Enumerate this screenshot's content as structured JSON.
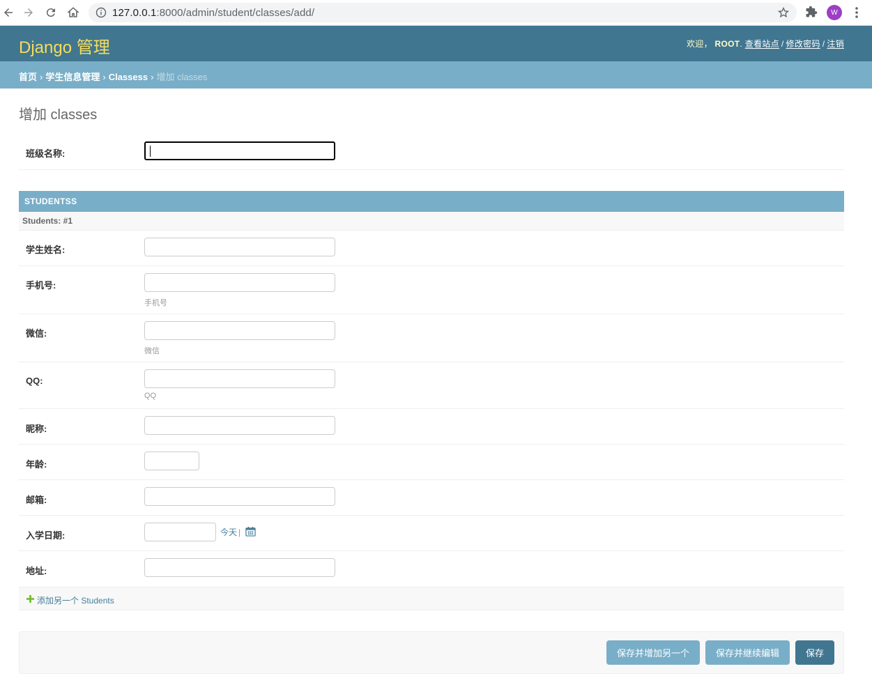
{
  "browser": {
    "url_host": "127.0.0.1",
    "url_rest": ":8000/admin/student/classes/add/",
    "avatar_letter": "W"
  },
  "header": {
    "brand": "Django 管理",
    "welcome": "欢迎，",
    "username": "ROOT",
    "view_site": "查看站点",
    "change_password": "修改密码",
    "logout": "注销"
  },
  "breadcrumbs": {
    "home": "首页",
    "app": "学生信息管理",
    "model": "Classess",
    "current": "增加 classes"
  },
  "page": {
    "title": "增加 classes",
    "class_name_label": "班级名称:"
  },
  "inline": {
    "heading": "STUDENTSS",
    "subheading": "Students: #1",
    "fields": {
      "name": "学生姓名:",
      "phone": "手机号:",
      "phone_help": "手机号",
      "wechat": "微信:",
      "wechat_help": "微信",
      "qq": "QQ:",
      "qq_help": "QQ",
      "nickname": "昵称:",
      "age": "年龄:",
      "email": "邮箱:",
      "enroll_date": "入学日期:",
      "address": "地址:"
    },
    "today_label": "今天",
    "today_sep": "|",
    "add_another": "添加另一个 Students"
  },
  "submit": {
    "save_add_another": "保存并增加另一个",
    "save_continue": "保存并继续编辑",
    "save": "保存"
  },
  "colors": {
    "header_bg": "#417690",
    "breadcrumb_bg": "#79aec8",
    "brand_yellow": "#f5dd5d",
    "link": "#447e9b"
  }
}
